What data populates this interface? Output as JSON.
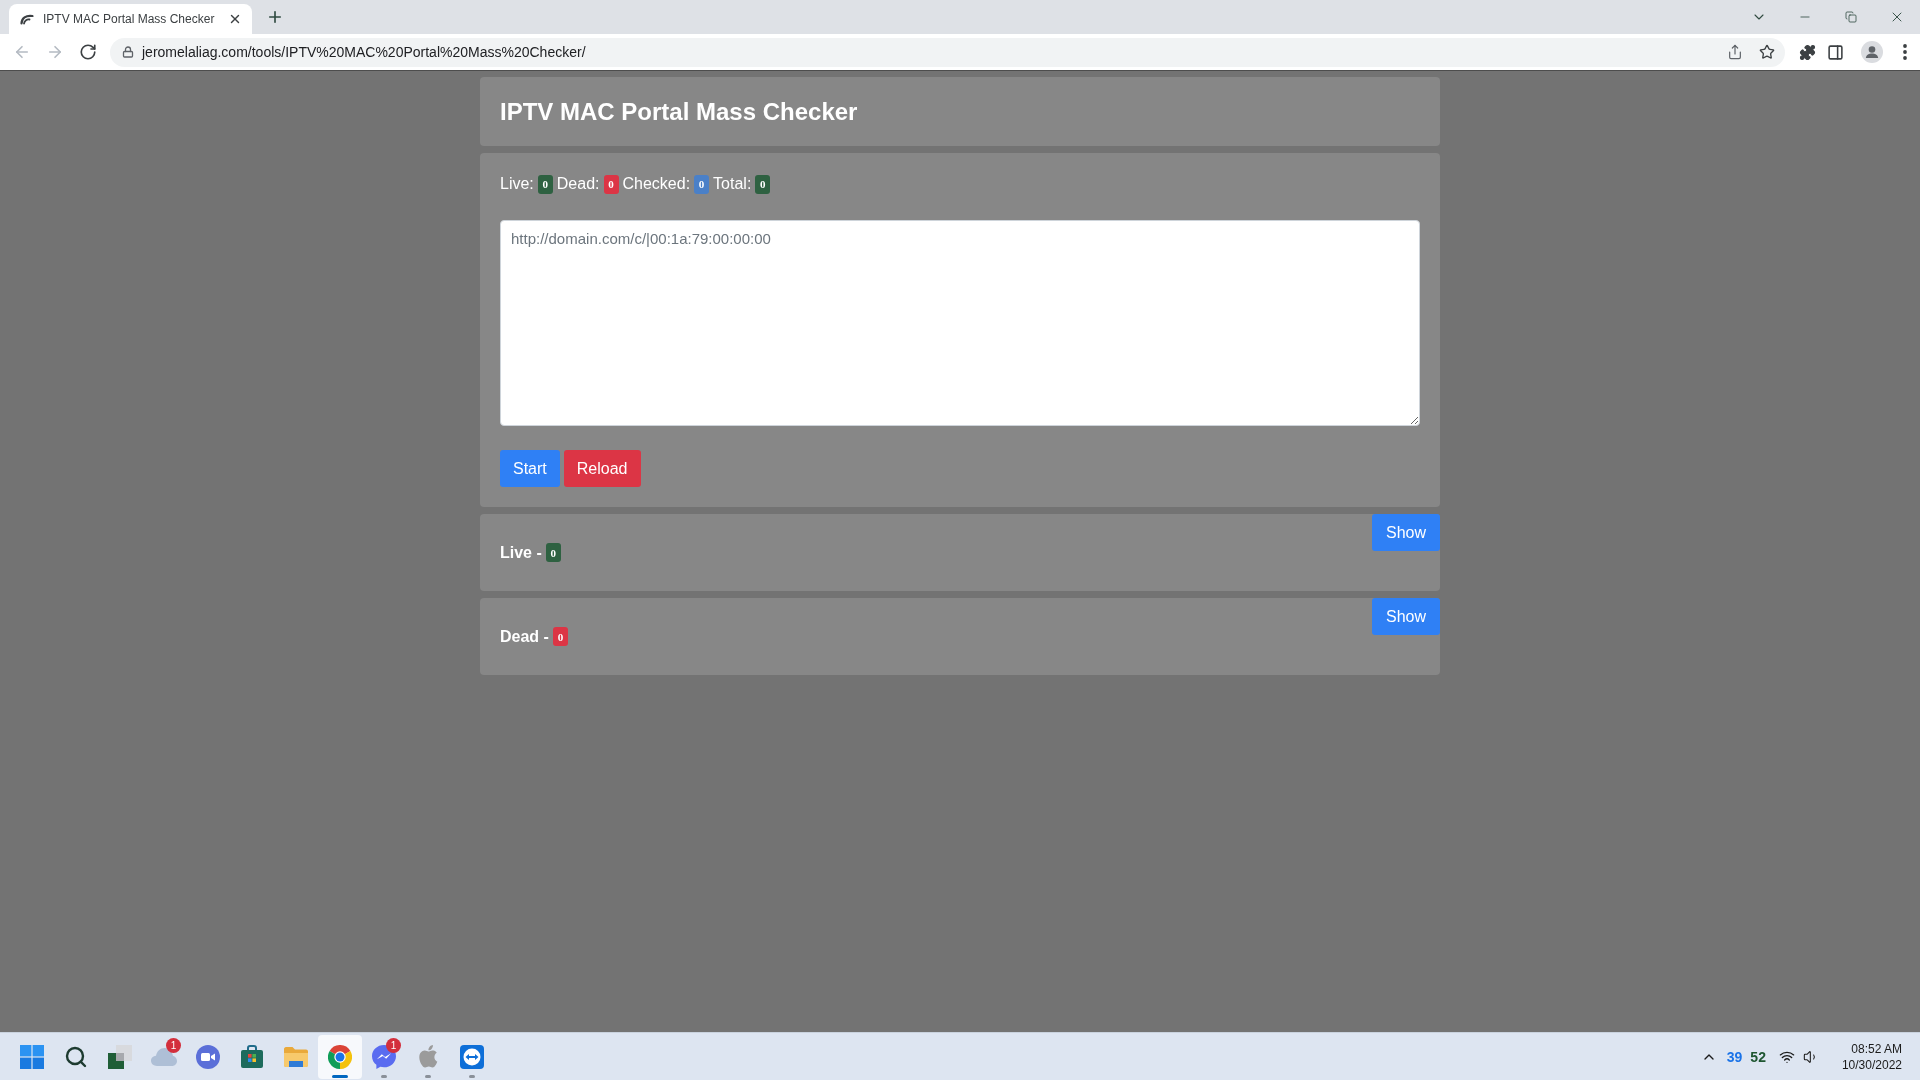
{
  "browser": {
    "tabs": [
      {
        "title": "IPTV MAC Portal Mass Checker",
        "selected": true
      }
    ],
    "nav_buttons": [
      {
        "kind": "back",
        "disabled": true
      },
      {
        "kind": "forward",
        "disabled": true
      },
      {
        "kind": "reload",
        "disabled": false
      }
    ],
    "address": "jeromelaliag.com/tools/IPTV%20MAC%20Portal%20Mass%20Checker/"
  },
  "page": {
    "title": "IPTV MAC Portal Mass Checker",
    "counters": [
      {
        "label": "Live:",
        "value": "0",
        "color": "#2e6141"
      },
      {
        "label": "Dead:",
        "value": "0",
        "color": "#dc3545"
      },
      {
        "label": "Checked:",
        "value": "0",
        "color": "#4a80c8"
      },
      {
        "label": "Total:",
        "value": "0",
        "color": "#2e6141"
      }
    ],
    "portal_input": {
      "placeholder": "http://domain.com/c/|00:1a:79:00:00:00"
    },
    "buttons": [
      {
        "label": "Start",
        "kind": "primary"
      },
      {
        "label": "Reload",
        "kind": "danger"
      }
    ],
    "results": [
      {
        "title": "Live -",
        "count": "0",
        "color": "#2e6141",
        "button": "Show"
      },
      {
        "title": "Dead -",
        "count": "0",
        "color": "#dc3545",
        "button": "Show"
      }
    ]
  },
  "taskbar": {
    "apps": [
      {
        "kind": "start",
        "selected": false,
        "running": false
      },
      {
        "kind": "search",
        "selected": false,
        "running": false
      },
      {
        "kind": "squares",
        "selected": false,
        "running": false
      },
      {
        "kind": "cloud",
        "badge": "1",
        "selected": false,
        "running": false
      },
      {
        "kind": "video",
        "selected": false,
        "running": false
      },
      {
        "kind": "bag",
        "selected": false,
        "running": false
      },
      {
        "kind": "folder",
        "selected": false,
        "running": false
      },
      {
        "kind": "browser",
        "selected": true,
        "running": true
      },
      {
        "kind": "chat",
        "badge": "1",
        "selected": false,
        "running": true
      },
      {
        "kind": "apple",
        "selected": false,
        "running": true
      },
      {
        "kind": "remote",
        "selected": false,
        "running": true
      }
    ],
    "tray": {
      "readings": [
        {
          "value": "39",
          "color": "#1a73e8"
        },
        {
          "value": "52",
          "color": "#1e5631"
        }
      ],
      "time": "08:52 AM",
      "date": "10/30/2022"
    }
  }
}
